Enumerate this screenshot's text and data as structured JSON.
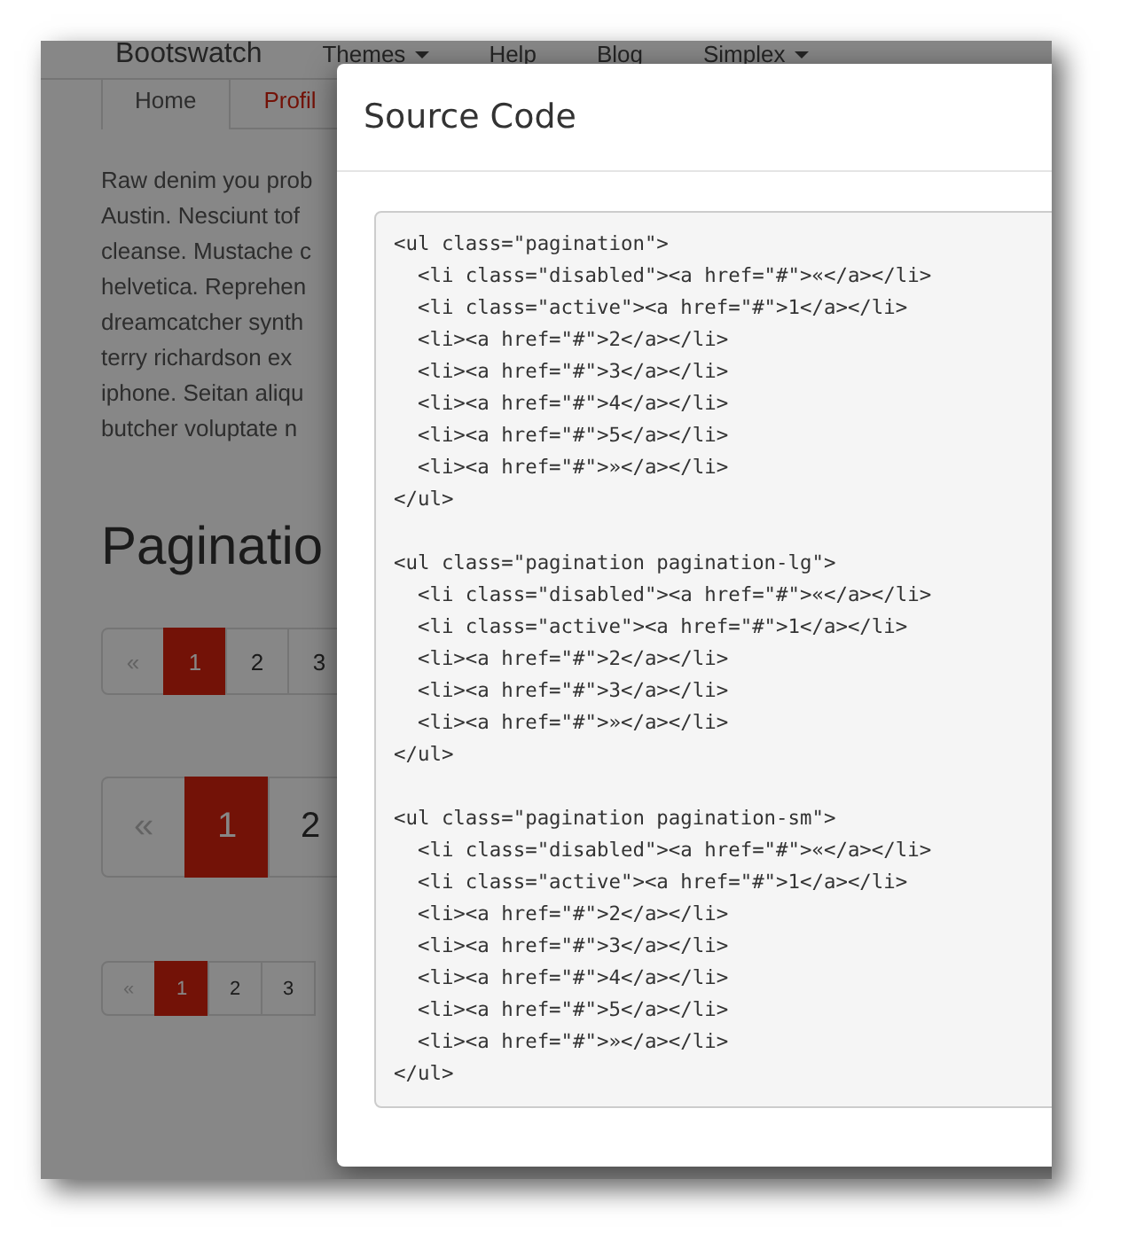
{
  "navbar": {
    "brand": "Bootswatch",
    "items": [
      {
        "label": "Themes",
        "dropdown": true
      },
      {
        "label": "Help",
        "dropdown": false
      },
      {
        "label": "Blog",
        "dropdown": false
      },
      {
        "label": "Simplex",
        "dropdown": true
      }
    ]
  },
  "tabs": [
    {
      "label": "Home",
      "selected": true
    },
    {
      "label": "Profil",
      "selected": false
    }
  ],
  "paragraph_lines": [
    "Raw denim you prob",
    "Austin. Nesciunt tof",
    "cleanse. Mustache c",
    "helvetica. Reprehen",
    "dreamcatcher synth",
    "terry richardson ex",
    "iphone. Seitan aliqu",
    "butcher voluptate n"
  ],
  "heading": "Paginatio",
  "paginations": [
    {
      "kind": "default",
      "items": [
        {
          "label": "«",
          "disabled": true,
          "selected": false
        },
        {
          "label": "1",
          "disabled": false,
          "selected": true
        },
        {
          "label": "2",
          "disabled": false,
          "selected": false
        },
        {
          "label": "3",
          "disabled": false,
          "selected": false
        }
      ]
    },
    {
      "kind": "large",
      "items": [
        {
          "label": "«",
          "disabled": true,
          "selected": false
        },
        {
          "label": "1",
          "disabled": false,
          "selected": true
        },
        {
          "label": "2",
          "disabled": false,
          "selected": false
        }
      ]
    },
    {
      "kind": "small",
      "items": [
        {
          "label": "«",
          "disabled": true,
          "selected": false
        },
        {
          "label": "1",
          "disabled": false,
          "selected": true
        },
        {
          "label": "2",
          "disabled": false,
          "selected": false
        },
        {
          "label": "3",
          "disabled": false,
          "selected": false
        }
      ]
    }
  ],
  "modal": {
    "title": "Source Code",
    "code_blocks": [
      [
        "<ul class=\"pagination\">",
        "  <li class=\"disabled\"><a href=\"#\">«</a></li>",
        "  <li class=\"active\"><a href=\"#\">1</a></li>",
        "  <li><a href=\"#\">2</a></li>",
        "  <li><a href=\"#\">3</a></li>",
        "  <li><a href=\"#\">4</a></li>",
        "  <li><a href=\"#\">5</a></li>",
        "  <li><a href=\"#\">»</a></li>",
        "</ul>"
      ],
      [
        "<ul class=\"pagination pagination-lg\">",
        "  <li class=\"disabled\"><a href=\"#\">«</a></li>",
        "  <li class=\"active\"><a href=\"#\">1</a></li>",
        "  <li><a href=\"#\">2</a></li>",
        "  <li><a href=\"#\">3</a></li>",
        "  <li><a href=\"#\">»</a></li>",
        "</ul>"
      ],
      [
        "<ul class=\"pagination pagination-sm\">",
        "  <li class=\"disabled\"><a href=\"#\">«</a></li>",
        "  <li class=\"active\"><a href=\"#\">1</a></li>",
        "  <li><a href=\"#\">2</a></li>",
        "  <li><a href=\"#\">3</a></li>",
        "  <li><a href=\"#\">4</a></li>",
        "  <li><a href=\"#\">5</a></li>",
        "  <li><a href=\"#\">»</a></li>",
        "</ul>"
      ]
    ]
  }
}
